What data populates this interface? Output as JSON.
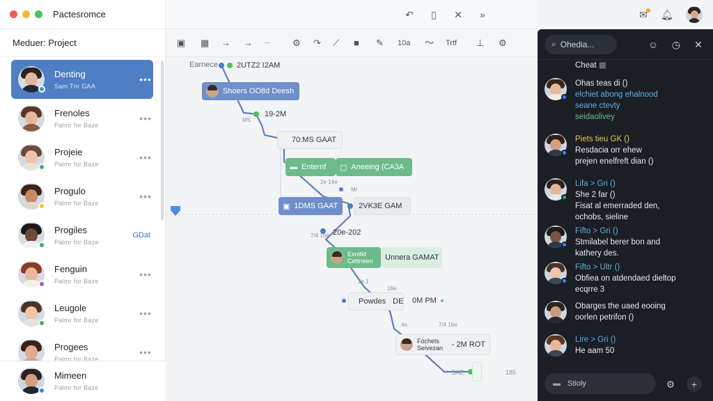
{
  "app": {
    "title": "Pactesromce",
    "window_dots": [
      "#ee5a52",
      "#f5b83b",
      "#4cc05a"
    ]
  },
  "sidebar": {
    "title": "Meduer: Project",
    "contacts": [
      {
        "name": "Denting",
        "sub": "Sam Tnr GAA",
        "status": "#2ea3a8",
        "hair": "#2c2420",
        "skin": "#e3b89a",
        "shirt": "#1f2937",
        "more": "•••"
      },
      {
        "name": "Frenoles",
        "sub": "Palmr for Baze",
        "status": "",
        "hair": "#5a3526",
        "skin": "#e8b79a",
        "shirt": "#8b5a45",
        "more": "•••"
      },
      {
        "name": "Projeie",
        "sub": "Palmr for Baze",
        "status": "#34b35a",
        "hair": "#6b4a3a",
        "skin": "#efc3a7",
        "shirt": "#ebe5df",
        "more": "•••"
      },
      {
        "name": "Progulo",
        "sub": "Palmr for Baze",
        "status": "#f0c33c",
        "hair": "#3b2418",
        "skin": "#c48a63",
        "shirt": "#e2d6cc",
        "more": "•••"
      },
      {
        "name": "Progiles",
        "sub": "Palmr for Baze",
        "status": "#34b35a",
        "hair": "#1f1a17",
        "skin": "#6b4a36",
        "shirt": "#f2f2f2",
        "more": "",
        "tag": "GDat"
      },
      {
        "name": "Fenguin",
        "sub": "Palmr for Baze",
        "status": "#9b5bd1",
        "hair": "#8a3b2a",
        "skin": "#e9b89c",
        "shirt": "#f2efe8",
        "more": "•••"
      },
      {
        "name": "Leugole",
        "sub": "Palmr for Baze",
        "status": "#34b35a",
        "hair": "#4a3326",
        "skin": "#efc4a8",
        "shirt": "#e9e2dc",
        "more": "•••"
      },
      {
        "name": "Progees",
        "sub": "Palmr for Baze",
        "status": "",
        "hair": "#3a2419",
        "skin": "#e2ab8d",
        "shirt": "#c9a89a",
        "more": "•••"
      }
    ],
    "bottom_contact": {
      "name": "Mimeen",
      "sub": "Palmr for Baze",
      "status": "#3b82f6",
      "hair": "#2a221e",
      "skin": "#d59e7e",
      "shirt": "#222831"
    }
  },
  "header": {
    "icons": [
      "undo-arrow-icon",
      "bookmark-icon",
      "close-icon",
      "chevrons-icon"
    ],
    "right_icons": [
      "compose-icon",
      "bell-icon",
      "user-avatar"
    ]
  },
  "toolbar": {
    "items": [
      "panel-icon",
      "grid-icon",
      "arrow-right-icon",
      "arrow-right-icon",
      "minus-icon",
      "settings-gear-icon",
      "redo-icon",
      "wand-icon",
      "folder-icon",
      "pen-icon",
      "10a",
      "wave-icon",
      "Trtf",
      "align-icon",
      "cog-icon"
    ],
    "text_10a": "10a",
    "text_trtf": "Trtf"
  },
  "diagram": {
    "nodes": [
      {
        "label": "Earnece",
        "kind": "text"
      },
      {
        "label": "2UTZ2 I2AM",
        "kind": "text"
      },
      {
        "label": "Shoers OO8d Deesh",
        "kind": "blue"
      },
      {
        "label": "19-2M",
        "kind": "text"
      },
      {
        "label": "70:MS GAAT",
        "kind": "grey"
      },
      {
        "label": "Enternf",
        "kind": "green"
      },
      {
        "label": "Aneeing (CA3A",
        "kind": "green"
      },
      {
        "label": "1DMS GAAT",
        "kind": "blue"
      },
      {
        "label": "2VK3E GAM",
        "kind": "grey"
      },
      {
        "label": "20e-202",
        "kind": "text"
      },
      {
        "label": "Exnitkt Cettneen",
        "kind": "green"
      },
      {
        "label": "Unnera GAMAT",
        "kind": "lgreen"
      },
      {
        "label": "Powdes",
        "kind": "grey"
      },
      {
        "label": "DE",
        "kind": "text"
      },
      {
        "label": "0M PM",
        "kind": "text"
      },
      {
        "label": "Fochets Seivezan",
        "kind": "grey"
      },
      {
        "label": "- 2M ROT",
        "kind": "grey"
      },
      {
        "label": "SAE",
        "kind": "text"
      },
      {
        "label": "185",
        "kind": "text"
      }
    ],
    "tiny_labels": [
      "MS",
      "2e 14e",
      "Mr",
      "7/4 16e",
      "2e 1",
      "16e",
      "4e",
      "7/4 16e"
    ]
  },
  "chat": {
    "search_placeholder": "Ohedia...",
    "top_label": "Cheat",
    "messages": [
      {
        "lines": [
          {
            "t": "Ohas teas di ()",
            "c": ""
          },
          {
            "t": "elchiet abong ehalnood",
            "c": "blue"
          },
          {
            "t": "seane ctevty",
            "c": "blue"
          },
          {
            "t": "seidaolivey",
            "c": "green"
          }
        ],
        "av": {
          "hair": "#3a2419",
          "skin": "#e8b79a",
          "shirt": "#f1ece6",
          "status": "#3b82f6"
        }
      },
      {
        "lines": [
          {
            "t": "Piets tieu GK ()",
            "c": "yellow"
          },
          {
            "t": "Resdacia orr ehew",
            "c": ""
          },
          {
            "t": "prejen enelfreft dian ()",
            "c": ""
          }
        ],
        "av": {
          "hair": "#2a221e",
          "skin": "#d59e7e",
          "shirt": "#2f3a48",
          "status": "#3b82f6"
        }
      },
      {
        "lines": [
          {
            "t": "Lifa > Gri ()",
            "c": "blue"
          },
          {
            "t": "She 2 far ()",
            "c": ""
          },
          {
            "t": "Fisat al emerraded den,",
            "c": ""
          },
          {
            "t": "ochobs, sieline",
            "c": ""
          }
        ],
        "av": {
          "hair": "#2a221e",
          "skin": "#e3b89a",
          "shirt": "#e9e9e9",
          "status": "#34b35a"
        }
      },
      {
        "lines": [
          {
            "t": "Fifto > Gri ()",
            "c": "blue"
          },
          {
            "t": "Stmilabel berer bon and",
            "c": ""
          },
          {
            "t": "kathery des.",
            "c": ""
          }
        ],
        "av": {
          "hair": "#1f1a17",
          "skin": "#7a5440",
          "shirt": "#2f3a48",
          "status": "#3b82f6"
        }
      },
      {
        "lines": [
          {
            "t": "Fifto > Ultr ()",
            "c": "blue"
          },
          {
            "t": "Obfiea on atdendaed dieltop",
            "c": ""
          },
          {
            "t": "ecqrre 3",
            "c": ""
          }
        ],
        "av": {
          "hair": "#4a3326",
          "skin": "#efc4a8",
          "shirt": "#3b4656",
          "status": "#3b82f6"
        }
      },
      {
        "lines": [
          {
            "t": "Obarges the uaed eooing",
            "c": ""
          },
          {
            "t": "oorlen petrifon ()",
            "c": ""
          }
        ],
        "av": {
          "hair": "#2a221e",
          "skin": "#c89a7e",
          "shirt": "#222831",
          "status": ""
        }
      },
      {
        "lines": [
          {
            "t": "Lire > Gri ()",
            "c": "blue"
          },
          {
            "t": "He aam 50",
            "c": ""
          }
        ],
        "av": {
          "hair": "#5a3526",
          "skin": "#e8b79a",
          "shirt": "#3b4656",
          "status": ""
        }
      }
    ],
    "input_placeholder": "Stioly"
  }
}
